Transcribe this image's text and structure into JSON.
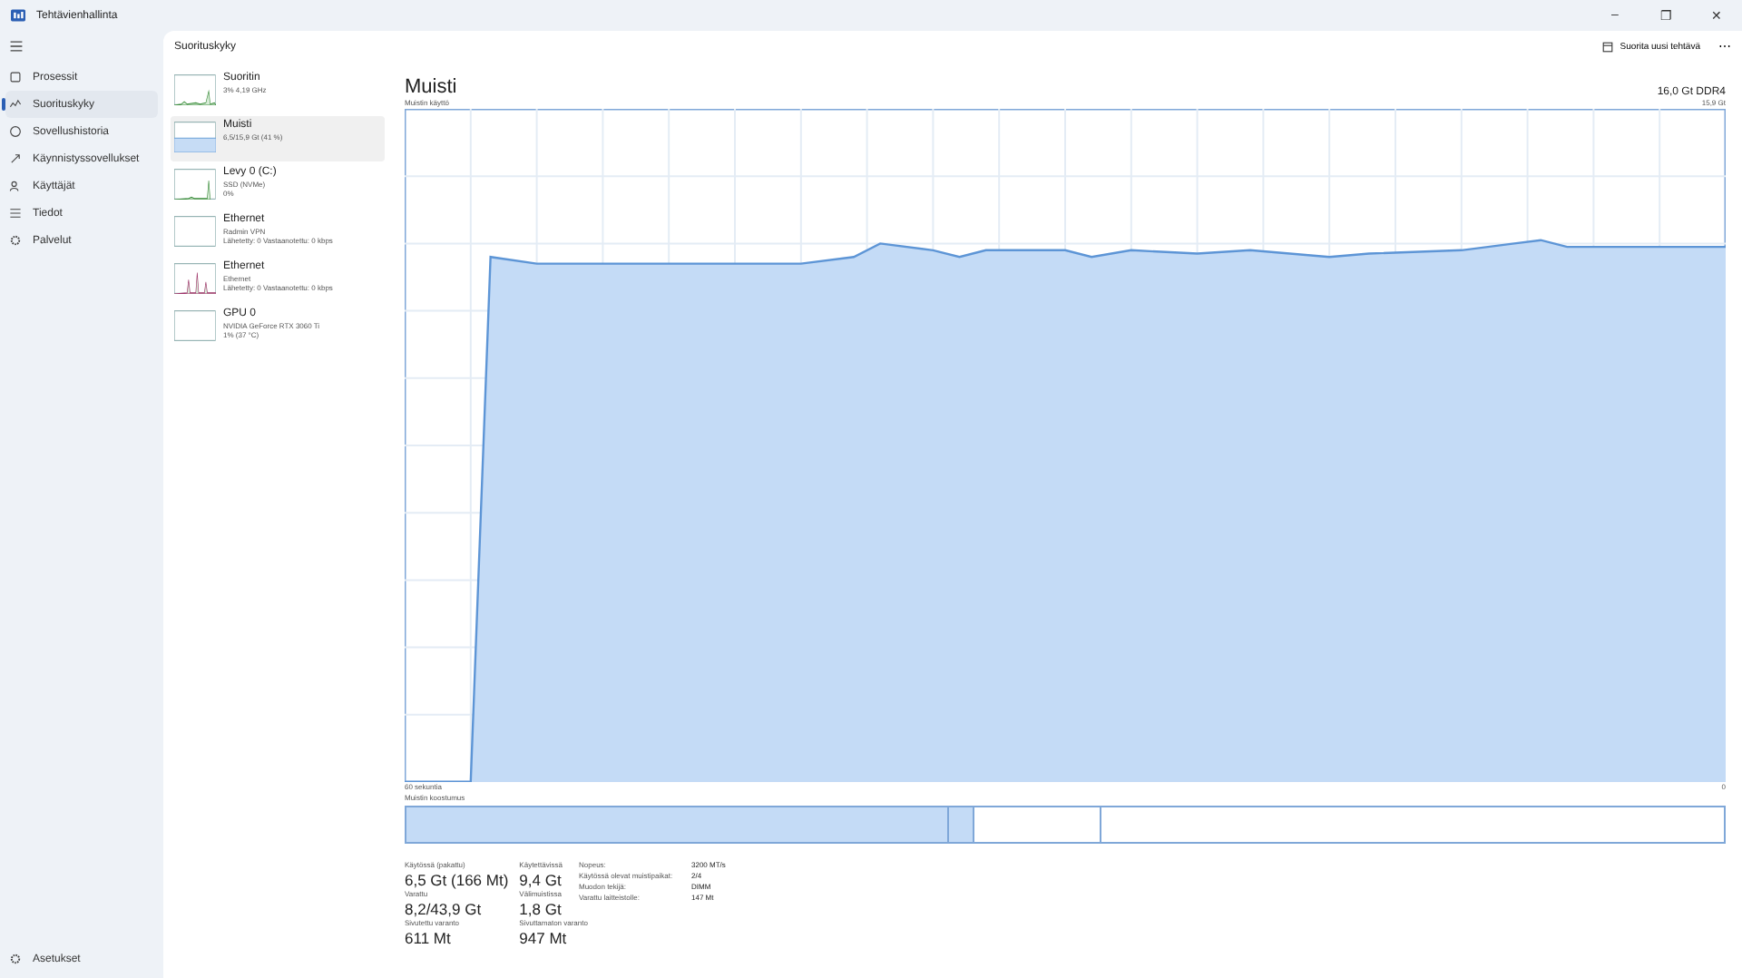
{
  "window": {
    "title": "Tehtävienhallinta",
    "controls": [
      "–",
      "❐",
      "✕"
    ]
  },
  "nav": {
    "items": [
      {
        "label": "Prosessit",
        "selected": false
      },
      {
        "label": "Suorituskyky",
        "selected": true
      },
      {
        "label": "Sovellushistoria",
        "selected": false
      },
      {
        "label": "Käynnistyssovellukset",
        "selected": false
      },
      {
        "label": "Käyttäjät",
        "selected": false
      },
      {
        "label": "Tiedot",
        "selected": false
      },
      {
        "label": "Palvelut",
        "selected": false
      }
    ],
    "settings": "Asetukset"
  },
  "header": {
    "title": "Suorituskyky",
    "run_task": "Suorita uusi tehtävä",
    "more": "⋯"
  },
  "devices": [
    {
      "name": "Suoritin",
      "lines": [
        "3% 4,19 GHz"
      ],
      "selected": false
    },
    {
      "name": "Muisti",
      "lines": [
        "6,5/15,9 Gt (41 %)"
      ],
      "selected": true
    },
    {
      "name": "Levy 0 (C:)",
      "lines": [
        "SSD (NVMe)",
        "0%"
      ],
      "selected": false
    },
    {
      "name": "Ethernet",
      "lines": [
        "Radmin VPN",
        "Lähetetty: 0 Vastaanotettu: 0 kbps"
      ],
      "selected": false
    },
    {
      "name": "Ethernet",
      "lines": [
        "Ethernet",
        "Lähetetty: 0 Vastaanotettu: 0 kbps"
      ],
      "selected": false
    },
    {
      "name": "GPU 0",
      "lines": [
        "NVIDIA GeForce RTX 3060 Ti",
        "1% (37 °C)"
      ],
      "selected": false
    }
  ],
  "detail": {
    "title": "Muisti",
    "spec": "16,0 Gt DDR4",
    "usage_label": "Muistin käyttö",
    "max_label": "15,9 Gt",
    "time_label": "60 sekuntia",
    "zero_label": "0",
    "composition_label": "Muistin koostumus",
    "stats": [
      {
        "label": "Käytössä (pakattu)",
        "value": "6,5 Gt (166 Mt)"
      },
      {
        "label": "Käytettävissä",
        "value": "9,4 Gt"
      },
      {
        "label": "Varattu",
        "value": "8,2/43,9 Gt"
      },
      {
        "label": "Välimuistissa",
        "value": "1,8 Gt"
      },
      {
        "label": "Sivutettu varanto",
        "value": "611 Mt"
      },
      {
        "label": "Sivuttamaton varanto",
        "value": "947 Mt"
      }
    ],
    "props": [
      {
        "label": "Nopeus:",
        "value": "3200 MT/s"
      },
      {
        "label": "Käytössä olevat muistipaikat:",
        "value": "2/4"
      },
      {
        "label": "Muodon tekijä:",
        "value": "DIMM"
      },
      {
        "label": "Varattu laitteistolle:",
        "value": "147 Mt"
      }
    ]
  }
}
